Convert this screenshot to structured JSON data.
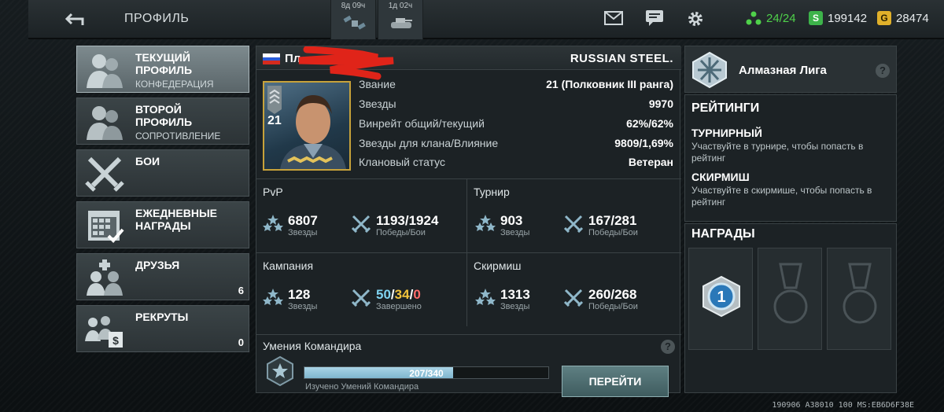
{
  "topbar": {
    "back_icon": "back-arrow-icon",
    "title": "ПРОФИЛЬ",
    "timers": [
      {
        "time": "8д 09ч",
        "icon": "satellite-icon"
      },
      {
        "time": "1д 02ч",
        "icon": "tank-icon"
      }
    ],
    "icons": [
      "mail-icon",
      "chat-icon",
      "gear-icon"
    ],
    "energy": "24/24",
    "silver": "199142",
    "gold": "28474"
  },
  "nav": [
    {
      "label1": "ТЕКУЩИЙ",
      "label2": "ПРОФИЛЬ",
      "sub": "КОНФЕДЕРАЦИЯ",
      "active": true
    },
    {
      "label1": "ВТОРОЙ",
      "label2": "ПРОФИЛЬ",
      "sub": "СОПРОТИВЛЕНИЕ",
      "active": false
    },
    {
      "label1": "БОИ",
      "label2": "",
      "sub": "",
      "active": false
    },
    {
      "label1": "ЕЖЕДНЕВНЫЕ",
      "label2": "НАГРАДЫ",
      "sub": "",
      "active": false
    },
    {
      "label1": "ДРУЗЬЯ",
      "label2": "",
      "sub": "",
      "count": "6",
      "active": false
    },
    {
      "label1": "РЕКРУТЫ",
      "label2": "",
      "sub": "",
      "count": "0",
      "active": false
    }
  ],
  "profile": {
    "player_name": "Пл",
    "clan": "RUSSIAN STEEL.",
    "rank_number": "21",
    "stats": [
      {
        "k": "Звание",
        "v": "21 (Полковник III ранга)"
      },
      {
        "k": "Звезды",
        "v": "9970"
      },
      {
        "k": "Винрейт общий/текущий",
        "v": "62%/62%"
      },
      {
        "k": "Звезды для клана/Влияние",
        "v": "9809/1,69%"
      },
      {
        "k": "Клановый статус",
        "v": "Ветеран"
      }
    ]
  },
  "modes": {
    "pvp": {
      "title": "PvP",
      "stars": "6807",
      "stars_lbl": "Звезды",
      "wins": "1193/1924",
      "wins_lbl": "Победы/Бои"
    },
    "tournament": {
      "title": "Турнир",
      "stars": "903",
      "stars_lbl": "Звезды",
      "wins": "167/281",
      "wins_lbl": "Победы/Бои"
    },
    "campaign": {
      "title": "Кампания",
      "stars": "128",
      "stars_lbl": "Звезды",
      "done_a": "50",
      "done_b": "34",
      "done_c": "0",
      "done_lbl": "Завершено"
    },
    "skirmish": {
      "title": "Скирмиш",
      "stars": "1313",
      "stars_lbl": "Звезды",
      "wins": "260/268",
      "wins_lbl": "Победы/Бои"
    }
  },
  "skills": {
    "title": "Умения Командира",
    "progress_text": "207/340",
    "progress_fraction": 0.609,
    "sub": "Изучено Умений Командира",
    "go_label": "ПЕРЕЙТИ"
  },
  "right": {
    "league": "Алмазная Лига",
    "ratings_title": "РЕЙТИНГИ",
    "tournament_title": "ТУРНИРНЫЙ",
    "tournament_desc": "Участвуйте в турнире, чтобы попасть в рейтинг",
    "skirmish_title": "СКИРМИШ",
    "skirmish_desc": "Участвуйте в скирмише, чтобы попасть в рейтинг",
    "awards_title": "НАГРАДЫ",
    "award_medal_number": "1"
  },
  "footer": "190906 A38010 100 MS:EB6D6F38E",
  "colors": {
    "accent_green": "#4fd14a",
    "campaign_blue": "#7fd3f0",
    "campaign_yellow": "#f0c23c",
    "campaign_red": "#ff6b6b"
  }
}
